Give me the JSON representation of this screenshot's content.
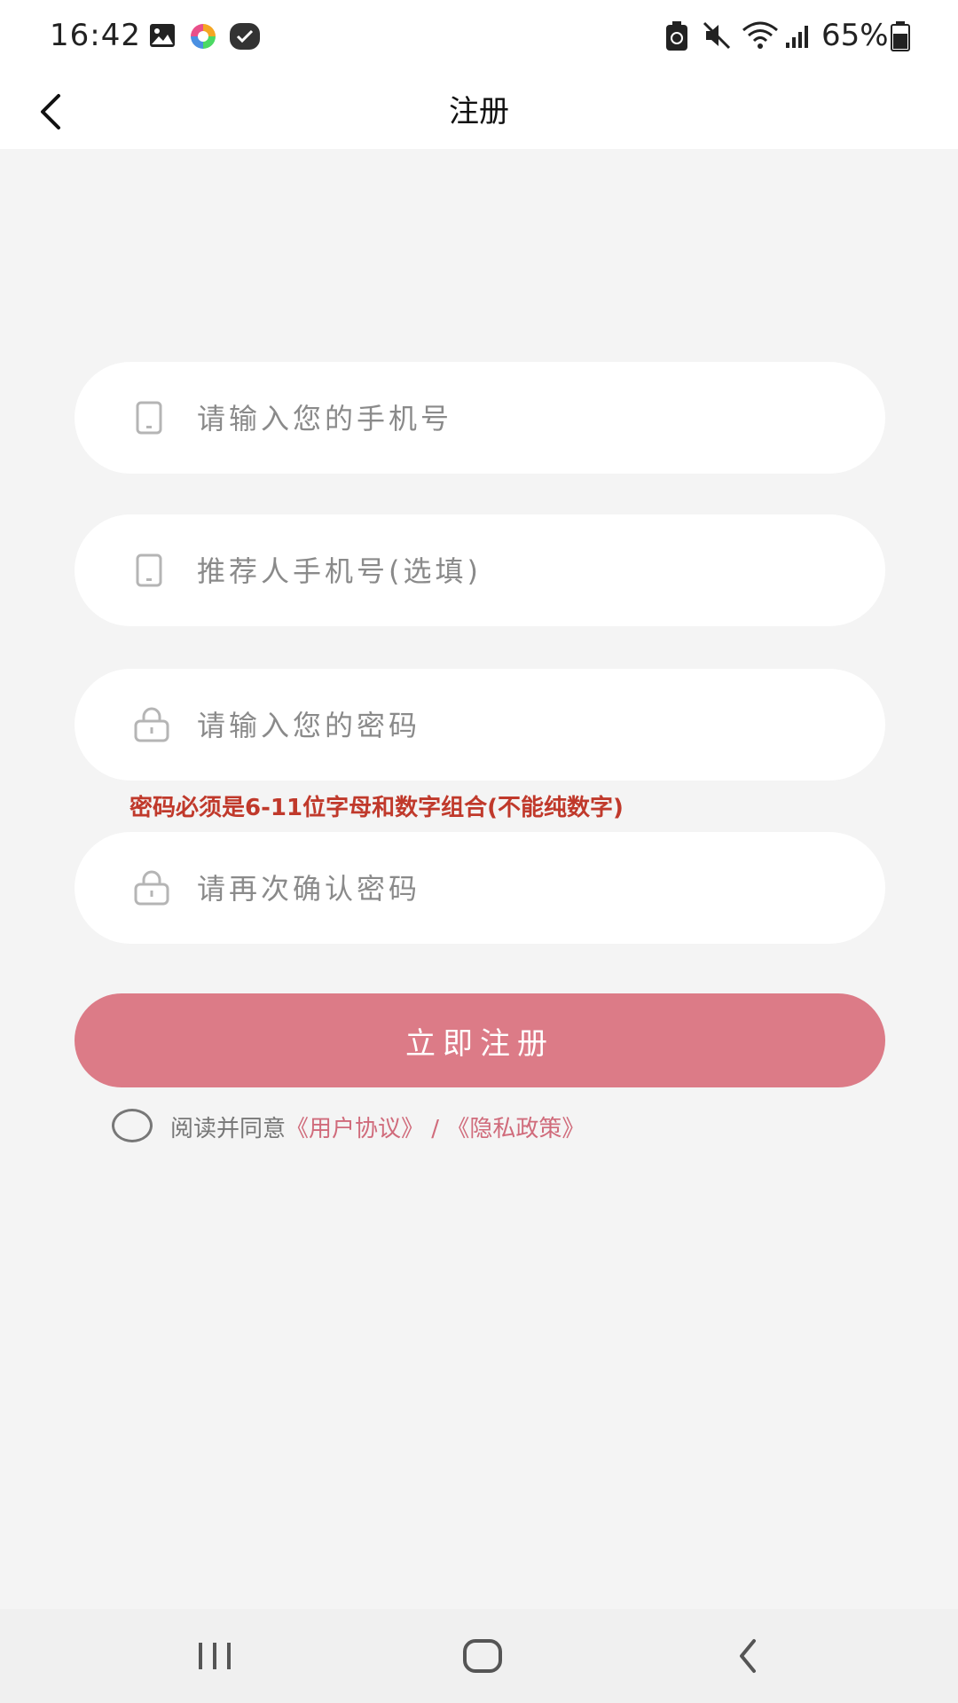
{
  "status_bar": {
    "time": "16:42",
    "battery": "65%",
    "icons": [
      "gallery-icon",
      "app-colorful-icon",
      "app-check-icon",
      "recycle-icon",
      "mute-icon",
      "wifi-icon",
      "signal-icon",
      "battery-icon"
    ]
  },
  "header": {
    "title": "注册",
    "back_icon": "chevron-left-icon"
  },
  "form": {
    "phone": {
      "placeholder": "请输入您的手机号",
      "value": "",
      "icon": "phone-icon"
    },
    "referrer": {
      "placeholder": "推荐人手机号(选填)",
      "value": "",
      "icon": "phone-icon"
    },
    "password": {
      "placeholder": "请输入您的密码",
      "value": "",
      "icon": "lock-icon"
    },
    "password_hint": "密码必须是6-11位字母和数字组合(不能纯数字)",
    "confirm": {
      "placeholder": "请再次确认密码",
      "value": "",
      "icon": "lock-icon"
    },
    "submit_label": "立即注册"
  },
  "agreement": {
    "prefix": "阅读并同意",
    "user_agreement": "《用户协议》",
    "separator": " / ",
    "privacy_policy": "《隐私政策》"
  },
  "nav_bar": {
    "icons": [
      "recent-apps-icon",
      "home-icon",
      "back-icon"
    ]
  },
  "colors": {
    "accent": "#dc7b87",
    "link": "#d06b7b",
    "hint": "#c0392b",
    "background": "#f4f4f4"
  }
}
